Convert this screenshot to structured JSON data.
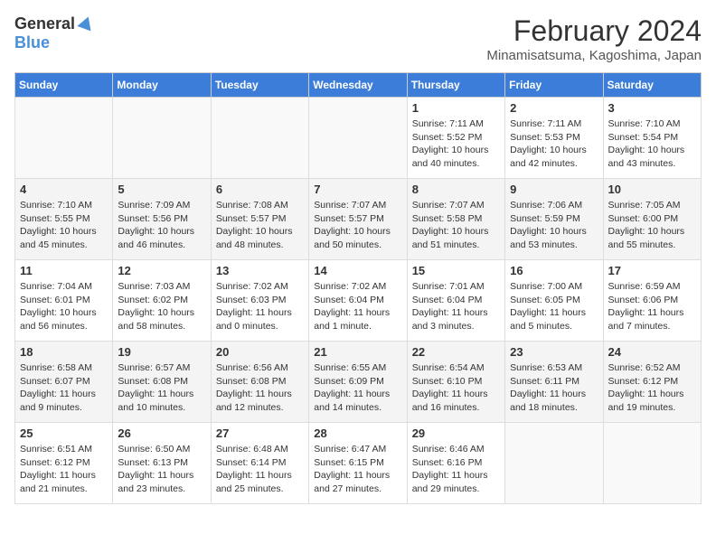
{
  "logo": {
    "general": "General",
    "blue": "Blue"
  },
  "header": {
    "month": "February 2024",
    "location": "Minamisatsuma, Kagoshima, Japan"
  },
  "days_of_week": [
    "Sunday",
    "Monday",
    "Tuesday",
    "Wednesday",
    "Thursday",
    "Friday",
    "Saturday"
  ],
  "weeks": [
    [
      {
        "day": "",
        "info": ""
      },
      {
        "day": "",
        "info": ""
      },
      {
        "day": "",
        "info": ""
      },
      {
        "day": "",
        "info": ""
      },
      {
        "day": "1",
        "info": "Sunrise: 7:11 AM\nSunset: 5:52 PM\nDaylight: 10 hours\nand 40 minutes."
      },
      {
        "day": "2",
        "info": "Sunrise: 7:11 AM\nSunset: 5:53 PM\nDaylight: 10 hours\nand 42 minutes."
      },
      {
        "day": "3",
        "info": "Sunrise: 7:10 AM\nSunset: 5:54 PM\nDaylight: 10 hours\nand 43 minutes."
      }
    ],
    [
      {
        "day": "4",
        "info": "Sunrise: 7:10 AM\nSunset: 5:55 PM\nDaylight: 10 hours\nand 45 minutes."
      },
      {
        "day": "5",
        "info": "Sunrise: 7:09 AM\nSunset: 5:56 PM\nDaylight: 10 hours\nand 46 minutes."
      },
      {
        "day": "6",
        "info": "Sunrise: 7:08 AM\nSunset: 5:57 PM\nDaylight: 10 hours\nand 48 minutes."
      },
      {
        "day": "7",
        "info": "Sunrise: 7:07 AM\nSunset: 5:57 PM\nDaylight: 10 hours\nand 50 minutes."
      },
      {
        "day": "8",
        "info": "Sunrise: 7:07 AM\nSunset: 5:58 PM\nDaylight: 10 hours\nand 51 minutes."
      },
      {
        "day": "9",
        "info": "Sunrise: 7:06 AM\nSunset: 5:59 PM\nDaylight: 10 hours\nand 53 minutes."
      },
      {
        "day": "10",
        "info": "Sunrise: 7:05 AM\nSunset: 6:00 PM\nDaylight: 10 hours\nand 55 minutes."
      }
    ],
    [
      {
        "day": "11",
        "info": "Sunrise: 7:04 AM\nSunset: 6:01 PM\nDaylight: 10 hours\nand 56 minutes."
      },
      {
        "day": "12",
        "info": "Sunrise: 7:03 AM\nSunset: 6:02 PM\nDaylight: 10 hours\nand 58 minutes."
      },
      {
        "day": "13",
        "info": "Sunrise: 7:02 AM\nSunset: 6:03 PM\nDaylight: 11 hours\nand 0 minutes."
      },
      {
        "day": "14",
        "info": "Sunrise: 7:02 AM\nSunset: 6:04 PM\nDaylight: 11 hours\nand 1 minute."
      },
      {
        "day": "15",
        "info": "Sunrise: 7:01 AM\nSunset: 6:04 PM\nDaylight: 11 hours\nand 3 minutes."
      },
      {
        "day": "16",
        "info": "Sunrise: 7:00 AM\nSunset: 6:05 PM\nDaylight: 11 hours\nand 5 minutes."
      },
      {
        "day": "17",
        "info": "Sunrise: 6:59 AM\nSunset: 6:06 PM\nDaylight: 11 hours\nand 7 minutes."
      }
    ],
    [
      {
        "day": "18",
        "info": "Sunrise: 6:58 AM\nSunset: 6:07 PM\nDaylight: 11 hours\nand 9 minutes."
      },
      {
        "day": "19",
        "info": "Sunrise: 6:57 AM\nSunset: 6:08 PM\nDaylight: 11 hours\nand 10 minutes."
      },
      {
        "day": "20",
        "info": "Sunrise: 6:56 AM\nSunset: 6:08 PM\nDaylight: 11 hours\nand 12 minutes."
      },
      {
        "day": "21",
        "info": "Sunrise: 6:55 AM\nSunset: 6:09 PM\nDaylight: 11 hours\nand 14 minutes."
      },
      {
        "day": "22",
        "info": "Sunrise: 6:54 AM\nSunset: 6:10 PM\nDaylight: 11 hours\nand 16 minutes."
      },
      {
        "day": "23",
        "info": "Sunrise: 6:53 AM\nSunset: 6:11 PM\nDaylight: 11 hours\nand 18 minutes."
      },
      {
        "day": "24",
        "info": "Sunrise: 6:52 AM\nSunset: 6:12 PM\nDaylight: 11 hours\nand 19 minutes."
      }
    ],
    [
      {
        "day": "25",
        "info": "Sunrise: 6:51 AM\nSunset: 6:12 PM\nDaylight: 11 hours\nand 21 minutes."
      },
      {
        "day": "26",
        "info": "Sunrise: 6:50 AM\nSunset: 6:13 PM\nDaylight: 11 hours\nand 23 minutes."
      },
      {
        "day": "27",
        "info": "Sunrise: 6:48 AM\nSunset: 6:14 PM\nDaylight: 11 hours\nand 25 minutes."
      },
      {
        "day": "28",
        "info": "Sunrise: 6:47 AM\nSunset: 6:15 PM\nDaylight: 11 hours\nand 27 minutes."
      },
      {
        "day": "29",
        "info": "Sunrise: 6:46 AM\nSunset: 6:16 PM\nDaylight: 11 hours\nand 29 minutes."
      },
      {
        "day": "",
        "info": ""
      },
      {
        "day": "",
        "info": ""
      }
    ]
  ]
}
